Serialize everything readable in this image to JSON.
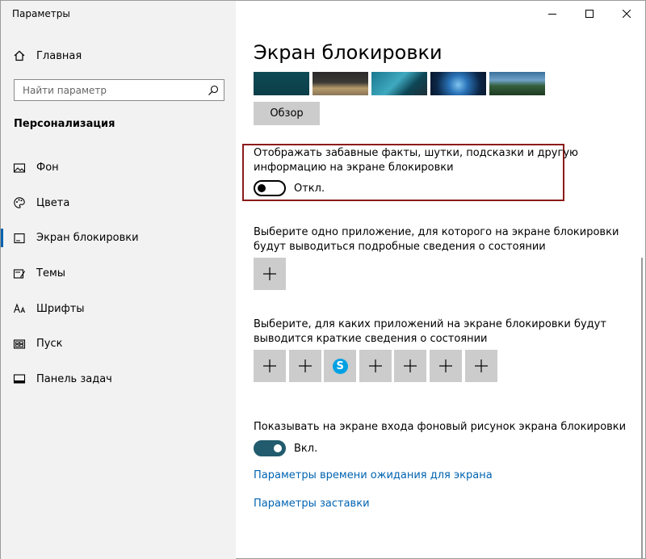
{
  "app": {
    "title": "Параметры"
  },
  "sidebar": {
    "home_label": "Главная",
    "search_placeholder": "Найти параметр",
    "section_title": "Персонализация",
    "items": [
      {
        "label": "Фон",
        "icon": "picture-icon"
      },
      {
        "label": "Цвета",
        "icon": "palette-icon"
      },
      {
        "label": "Экран блокировки",
        "icon": "lock-screen-icon",
        "active": true
      },
      {
        "label": "Темы",
        "icon": "themes-icon"
      },
      {
        "label": "Шрифты",
        "icon": "fonts-icon"
      },
      {
        "label": "Пуск",
        "icon": "start-icon"
      },
      {
        "label": "Панель задач",
        "icon": "taskbar-icon"
      }
    ]
  },
  "main": {
    "title": "Экран блокировки",
    "browse_label": "Обзор",
    "fun_facts": {
      "label_line1": "Отображать забавные факты, шутки, подсказки и другую",
      "label_line2": "информацию на экране блокировки",
      "state": "Откл."
    },
    "detailed_status": {
      "line1": "Выберите одно приложение, для которого на экране блокировки",
      "line2": "будут выводиться подробные сведения о состоянии"
    },
    "quick_status": {
      "line1": "Выберите, для каких приложений на экране блокировки будут",
      "line2": "выводится краткие сведения о состоянии",
      "slots": [
        "plus",
        "plus",
        "skype",
        "plus",
        "plus",
        "plus",
        "plus"
      ],
      "skype_letter": "S"
    },
    "show_background": {
      "label": "Показывать на экране входа фоновый рисунок экрана блокировки",
      "state": "Вкл."
    },
    "links": {
      "timeout": "Параметры времени ожидания для экрана",
      "screensaver": "Параметры заставки"
    }
  },
  "colors": {
    "accent": "#0063b1",
    "toggle_on": "#215b6d",
    "highlight_border": "#8b1a1a"
  }
}
